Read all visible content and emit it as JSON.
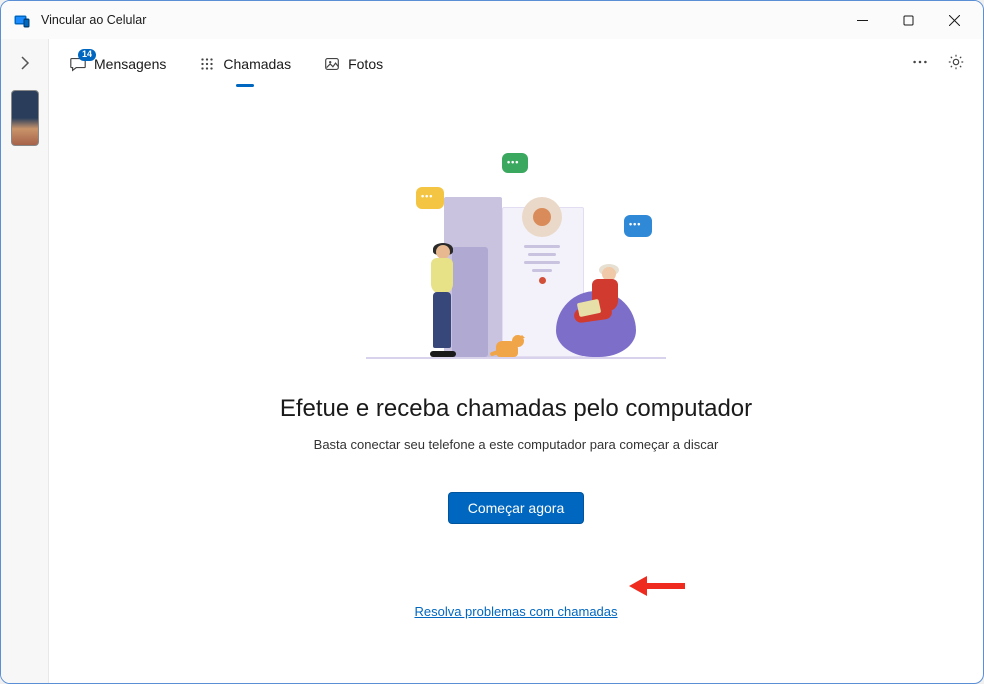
{
  "window": {
    "title": "Vincular ao Celular"
  },
  "tabs": {
    "messages": {
      "label": "Mensagens",
      "badge": "14"
    },
    "calls": {
      "label": "Chamadas"
    },
    "photos": {
      "label": "Fotos"
    }
  },
  "main": {
    "heading": "Efetue e receba chamadas pelo computador",
    "subheading": "Basta conectar seu telefone a este computador para começar a discar",
    "cta": "Começar agora",
    "troubleshoot": "Resolva problemas com chamadas"
  }
}
